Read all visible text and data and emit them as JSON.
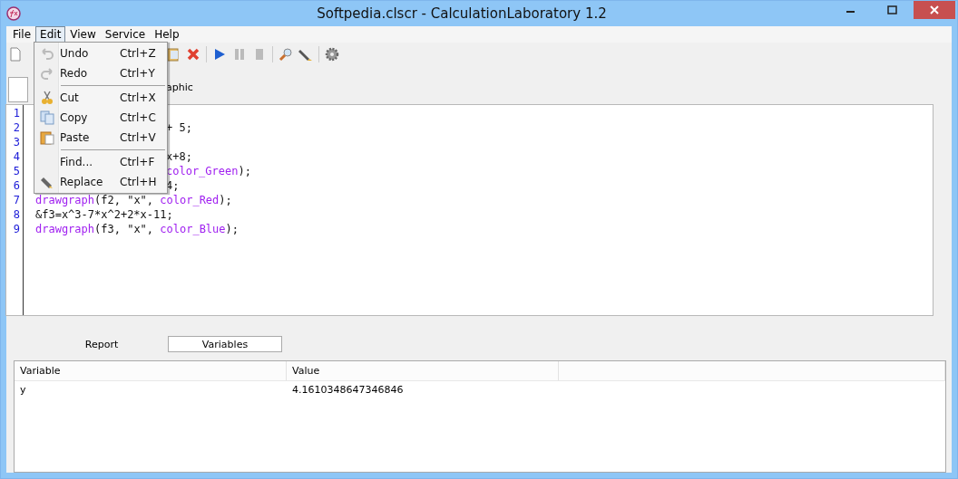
{
  "window": {
    "title": "Softpedia.clscr - CalculationLaboratory 1.2"
  },
  "menu_bar": [
    {
      "label": "File",
      "selected": false
    },
    {
      "label": "Edit",
      "selected": true
    },
    {
      "label": "View",
      "selected": false
    },
    {
      "label": "Service",
      "selected": false
    },
    {
      "label": "Help",
      "selected": false
    }
  ],
  "edit_menu": [
    {
      "kind": "undo",
      "label": "Undo",
      "shortcut": "Ctrl+Z",
      "disabled": false
    },
    {
      "kind": "redo",
      "label": "Redo",
      "shortcut": "Ctrl+Y",
      "disabled": false
    },
    {
      "kind": "separator"
    },
    {
      "kind": "cut",
      "label": "Cut",
      "shortcut": "Ctrl+X",
      "disabled": false
    },
    {
      "kind": "copy",
      "label": "Copy",
      "shortcut": "Ctrl+C",
      "disabled": false
    },
    {
      "kind": "paste",
      "label": "Paste",
      "shortcut": "Ctrl+V",
      "disabled": false
    },
    {
      "kind": "separator"
    },
    {
      "kind": "find",
      "label": "Find...",
      "shortcut": "Ctrl+F",
      "disabled": false
    },
    {
      "kind": "replace",
      "label": "Replace",
      "shortcut": "Ctrl+H",
      "disabled": false
    }
  ],
  "editor_tab": {
    "label": "aphic"
  },
  "code_lines": [
    {
      "number": "1",
      "kind": "partial"
    },
    {
      "number": "2",
      "kind": "partial",
      "tokens": [
        {
          "kind": "plain",
          "text": "+ 5;"
        }
      ]
    },
    {
      "number": "3",
      "kind": "partial"
    },
    {
      "number": "4",
      "kind": "partial",
      "tokens": [
        {
          "kind": "plain",
          "text": "x+8;"
        }
      ]
    },
    {
      "number": "5",
      "kind": "partial",
      "tokens": [
        {
          "kind": "keyword",
          "text": "color_Green"
        },
        {
          "kind": "plain",
          "text": ");"
        }
      ]
    },
    {
      "number": "6",
      "kind": "partial",
      "tokens": [
        {
          "kind": "plain",
          "text": "4;"
        }
      ]
    },
    {
      "number": "7",
      "kind": "full",
      "tokens": [
        {
          "kind": "keyword",
          "text": "drawgraph"
        },
        {
          "kind": "plain",
          "text": "(f2, \"x\", "
        },
        {
          "kind": "keyword",
          "text": "color_Red"
        },
        {
          "kind": "plain",
          "text": ");"
        }
      ]
    },
    {
      "number": "8",
      "kind": "full",
      "tokens": [
        {
          "kind": "plain",
          "text": "&f3=x^3-7*x^2+2*x-11;"
        }
      ]
    },
    {
      "number": "9",
      "kind": "full",
      "tokens": [
        {
          "kind": "keyword",
          "text": "drawgraph"
        },
        {
          "kind": "plain",
          "text": "(f3, \"x\", "
        },
        {
          "kind": "keyword",
          "text": "color_Blue"
        },
        {
          "kind": "plain",
          "text": ");"
        }
      ]
    }
  ],
  "bottom_tabs": [
    {
      "label": "Report",
      "selected": false
    },
    {
      "label": "Variables",
      "selected": true
    }
  ],
  "variables_table": {
    "columns": [
      "Variable",
      "Value"
    ],
    "rows": [
      [
        "y",
        "4.1610348647346846"
      ]
    ]
  }
}
